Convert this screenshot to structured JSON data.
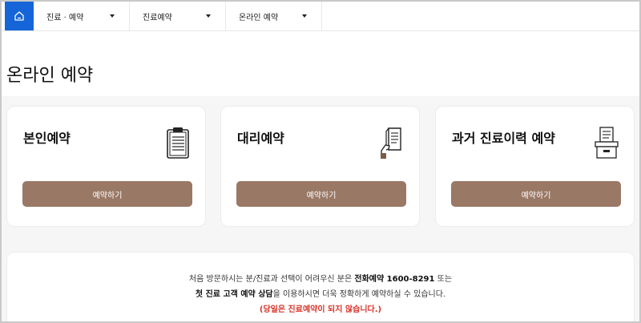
{
  "nav": {
    "home_label": "home",
    "items": [
      {
        "label": "진료 · 예약"
      },
      {
        "label": "진료예약"
      },
      {
        "label": "온라인 예약"
      }
    ]
  },
  "page_title": "온라인 예약",
  "cards": [
    {
      "title": "본인예약",
      "button": "예약하기",
      "icon": "clipboard-icon"
    },
    {
      "title": "대리예약",
      "button": "예약하기",
      "icon": "hand-document-icon"
    },
    {
      "title": "과거 진료이력 예약",
      "button": "예약하기",
      "icon": "archive-box-icon"
    }
  ],
  "notice": {
    "line1_pre": "처음 방문하시는 분/진료과 선택이 어려우신 분은 ",
    "line1_bold": "전화예약 1600-8291",
    "line1_post": " 또는",
    "line2_bold": "첫 진료 고객 예약 상담",
    "line2_post": "을 이용하시면 더욱 정확하게 예약하실 수 있습니다.",
    "line3_red": "(당일은 진료예약이 되지 않습니다.)"
  },
  "colors": {
    "home_blue": "#1565d8",
    "button_brown": "#9a7866",
    "notice_red": "#d8342b"
  }
}
